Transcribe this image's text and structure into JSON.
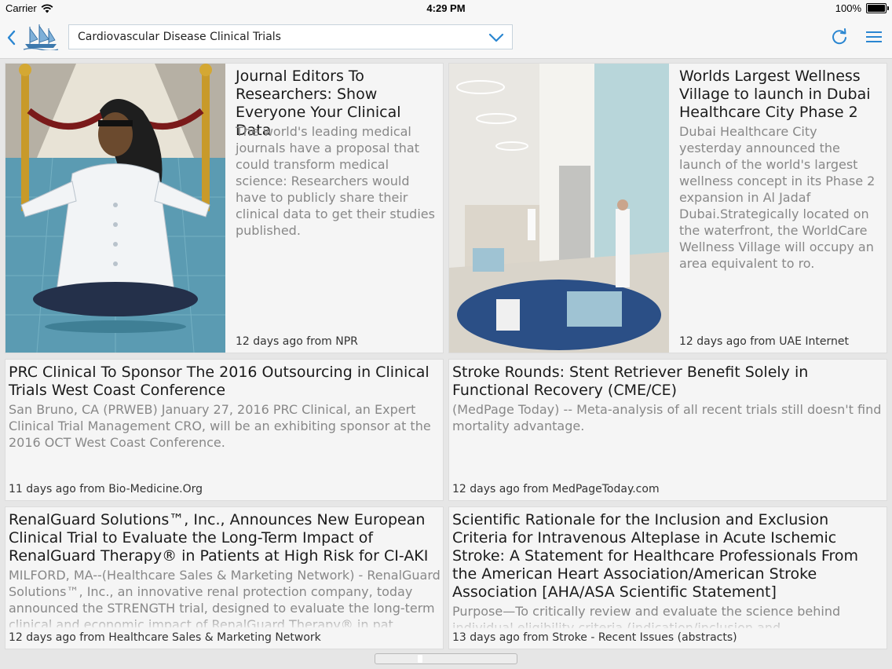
{
  "status": {
    "carrier": "Carrier",
    "time": "4:29 PM",
    "battery": "100%",
    "battery_level": 1.0
  },
  "nav": {
    "topic": "Cardiovascular Disease Clinical Trials",
    "accent": "#2a86d1"
  },
  "articles": [
    {
      "title": "Journal Editors To Researchers: Show Everyone Your Clinical Data",
      "snippet": "The world's leading medical journals have a proposal that could transform medical science: Researchers would have to publicly share their clinical data to get their studies published.",
      "meta": "12 days ago from NPR",
      "image": "scientist-illustration"
    },
    {
      "title": "Worlds Largest Wellness Village to launch in Dubai Healthcare City Phase 2",
      "snippet": "Dubai Healthcare City yesterday announced the launch of the world's largest wellness concept in its Phase 2 expansion in Al Jadaf Dubai.Strategically located on the waterfront, the WorldCare Wellness Village will occupy an area equivalent to ro.",
      "meta": "12 days ago from UAE Internet",
      "image": "wellness-lobby-photo"
    },
    {
      "title": "PRC Clinical To Sponsor The 2016 Outsourcing in Clinical Trials West Coast Conference",
      "snippet": "San Bruno, CA (PRWEB) January 27, 2016 PRC Clinical, an Expert Clinical Trial Management CRO, will be an exhibiting sponsor at the 2016 OCT West Coast Conference.",
      "meta": "11 days ago from Bio-Medicine.Org"
    },
    {
      "title": "Stroke Rounds: Stent Retriever Benefit Solely in Functional Recovery (CME/CE)",
      "snippet": "(MedPage Today) -- Meta-analysis of all recent trials still doesn't find mortality advantage.",
      "meta": "12 days ago from MedPageToday.com"
    },
    {
      "title": "RenalGuard Solutions™, Inc., Announces New European Clinical Trial to Evaluate the Long-Term Impact of RenalGuard Therapy® in Patients at High Risk for CI-AKI",
      "snippet": "MILFORD, MA--(Healthcare Sales & Marketing Network) - RenalGuard Solutions™, Inc., an innovative renal protection company, today announced the STRENGTH trial, designed to evaluate the long-term clinical and economic impact of RenalGuard Therapy® in pat",
      "meta": "12 days ago from Healthcare Sales & Marketing Network"
    },
    {
      "title": "Scientific Rationale for the Inclusion and Exclusion Criteria for Intravenous Alteplase in Acute Ischemic Stroke: A Statement for Healthcare Professionals From the American Heart Association/American Stroke Association [AHA/ASA Scientific Statement]",
      "snippet": "Purpose—To critically review and evaluate the science behind individual eligibility criteria (indication/inclusion and",
      "meta": "13 days ago from Stroke - Recent Issues (abstracts)"
    }
  ],
  "pager": {
    "current_page": 1
  }
}
